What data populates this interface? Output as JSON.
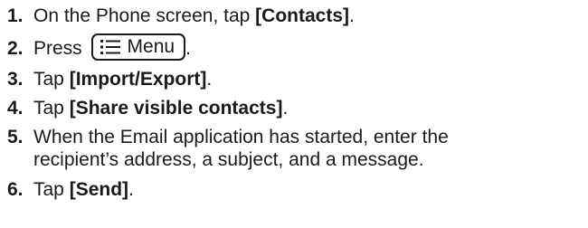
{
  "steps": [
    {
      "number": "1.",
      "text": "On the Phone screen, tap ",
      "bold": "[Contacts]",
      "after": "."
    },
    {
      "number": "2.",
      "text": "Press",
      "key_label": "Menu",
      "after": "."
    },
    {
      "number": "3.",
      "text": "Tap ",
      "bold": "[Import/Export]",
      "after": "."
    },
    {
      "number": "4.",
      "text": "Tap ",
      "bold": "[Share visible contacts]",
      "after": "."
    },
    {
      "number": "5.",
      "line1": "When the Email application has started, enter the",
      "line2": "recipient’s address, a subject, and a message."
    },
    {
      "number": "6.",
      "text": "Tap ",
      "bold": "[Send]",
      "after": "."
    }
  ],
  "icons": {
    "menu_key_icon": "menu-list-icon"
  }
}
